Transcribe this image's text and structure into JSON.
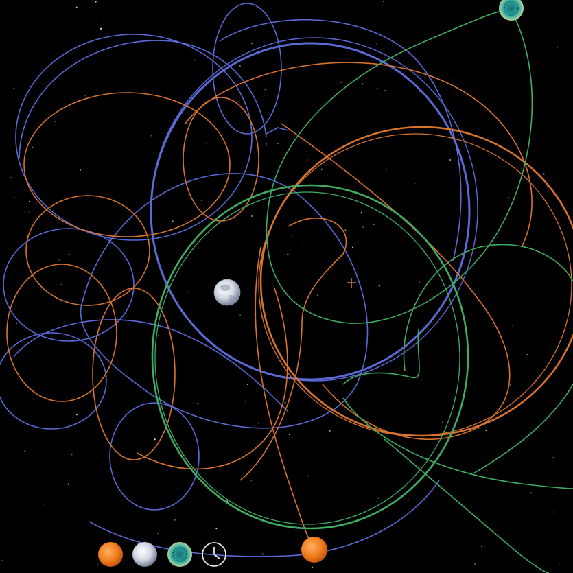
{
  "app": {
    "colors": {
      "background": "#000000",
      "orbit_blue": "#5a6ad6",
      "orbit_orange": "#d8742e",
      "orbit_green": "#3fae63",
      "crosshair": "#e08a2a",
      "sun": "#f07c1c",
      "earth": "#d8dde6",
      "alien_planet": "#2aa6a0"
    },
    "bodies": [
      {
        "id": "earth",
        "icon": "earth-icon"
      },
      {
        "id": "sun",
        "icon": "sun-icon"
      },
      {
        "id": "alien",
        "icon": "alien-planet-icon"
      }
    ],
    "center_marker": {
      "icon": "crosshair-icon"
    },
    "toolbar": {
      "buttons": [
        {
          "id": "focus-sun",
          "icon": "sun-icon"
        },
        {
          "id": "focus-earth",
          "icon": "earth-icon"
        },
        {
          "id": "focus-alien",
          "icon": "alien-planet-icon"
        },
        {
          "id": "time-control",
          "icon": "clock-icon"
        }
      ]
    }
  }
}
